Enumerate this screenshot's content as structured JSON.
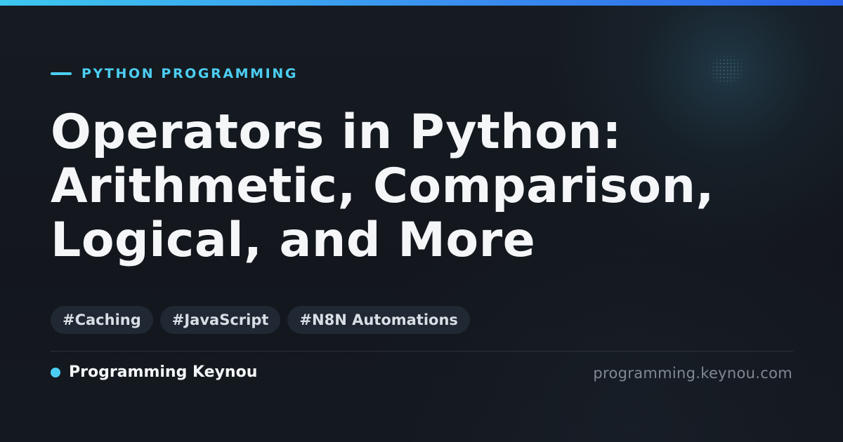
{
  "category": "PYTHON PROGRAMMING",
  "title": "Operators in Python: Arithmetic, Comparison, Logical, and More",
  "tags": [
    "#Caching",
    "#JavaScript",
    "#N8N Automations"
  ],
  "brand": {
    "name": "Programming Keynou"
  },
  "site_url": "programming.keynou.com",
  "colors": {
    "accent": "#4ccef2",
    "background": "#14181f",
    "title": "#f4f6f8",
    "tag_background": "#1f2833",
    "muted": "#7f8893"
  }
}
